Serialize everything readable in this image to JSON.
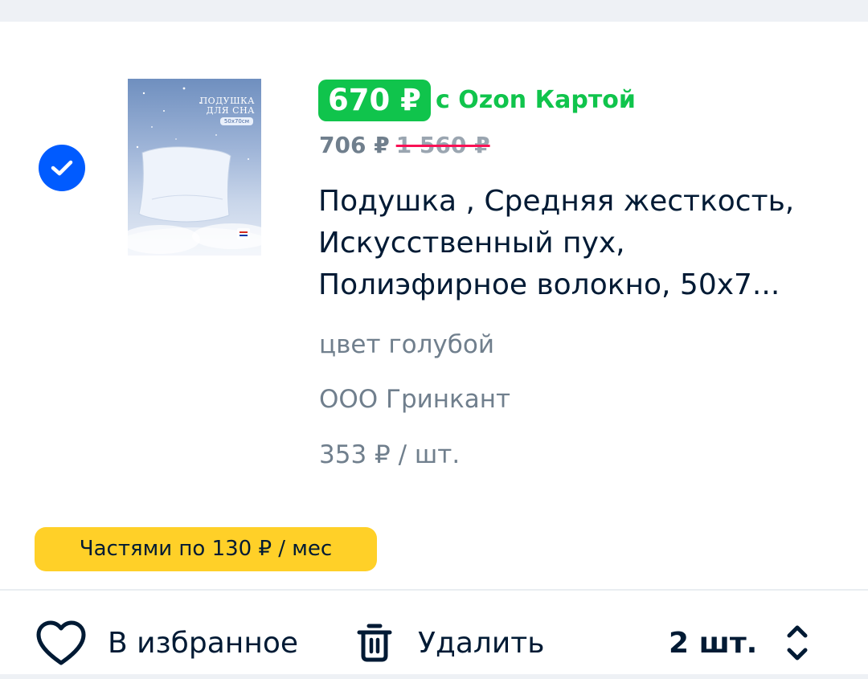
{
  "product": {
    "image_alt": "Подушка",
    "image_text": {
      "title_line1": "ПОДУШКА",
      "title_line2": "ДЛЯ СНА",
      "size": "50x70см"
    },
    "price_card": "670 ₽",
    "price_card_label": "с Ozon Картой",
    "price_current": "706 ₽",
    "price_original": "1 560 ₽",
    "title": "Подушка , Средняя жесткость, Искусственный пух, Полиэфирное волокно, 50x7...",
    "color": "цвет голубой",
    "seller": "ООО Гринкант",
    "unit_price": "353 ₽ / шт.",
    "selected": true
  },
  "installments": {
    "label": "Частями по 130 ₽ / мес"
  },
  "actions": {
    "favorite_label": "В избранное",
    "delete_label": "Удалить",
    "quantity": "2 шт."
  },
  "colors": {
    "ozon_blue": "#005bff",
    "ozon_green": "#10c44c",
    "strike_red": "#f91155",
    "installments_yellow": "#ffd028",
    "text_primary": "#001a34",
    "text_secondary": "#707f8d"
  },
  "icons": {
    "checkbox": "check-icon",
    "favorite": "heart-icon",
    "delete": "trash-icon",
    "quantity": "chevron-up-down-icon"
  }
}
